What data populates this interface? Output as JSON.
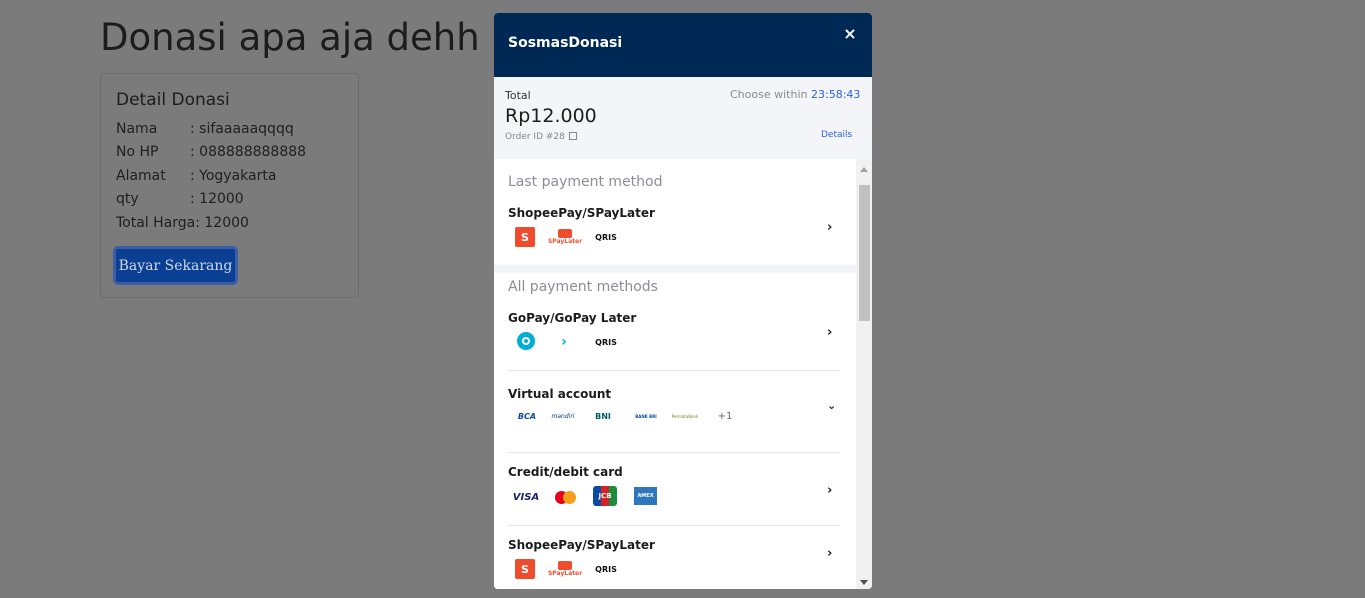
{
  "page": {
    "title": "Donasi apa aja dehh",
    "card_title": "Detail Donasi",
    "rows": [
      {
        "label": "Nama",
        "value": ": sifaaaaaqqqq"
      },
      {
        "label": "No HP",
        "value": ": 088888888888"
      },
      {
        "label": "Alamat",
        "value": ": Yogyakarta"
      },
      {
        "label": "qty",
        "value": ": 12000"
      },
      {
        "label": "Total Harga",
        "value": ": 12000"
      }
    ],
    "pay_button": "Bayar Sekarang"
  },
  "modal": {
    "brand": "SosmasDonasi",
    "close_icon": "×",
    "summary": {
      "total_label": "Total",
      "amount": "Rp12.000",
      "order_id": "Order ID #28",
      "choose_label": "Choose within",
      "timer": "23:58:43",
      "details_link": "Details"
    },
    "last_method_heading": "Last payment method",
    "all_methods_heading": "All payment methods",
    "methods": [
      {
        "title": "ShopeePay/SPayLater",
        "logos": [
          "S",
          "SPayLater",
          "QRIS"
        ]
      },
      {
        "title": "GoPay/GoPay Later",
        "logos": [
          "gopay-icon",
          "gopaylater-icon",
          "QRIS"
        ]
      },
      {
        "title": "Virtual account",
        "logos": [
          "BCA",
          "mandiri",
          "BNI",
          "BANK BRI",
          "PermataBank"
        ],
        "extra": "+1"
      },
      {
        "title": "Credit/debit card",
        "logos": [
          "VISA",
          "mastercard",
          "JCB",
          "AMEX"
        ]
      },
      {
        "title": "ShopeePay/SPayLater",
        "logos": [
          "S",
          "SPayLater",
          "QRIS"
        ]
      }
    ],
    "colors": {
      "header": "#002855",
      "accent": "#2b63d9"
    }
  }
}
